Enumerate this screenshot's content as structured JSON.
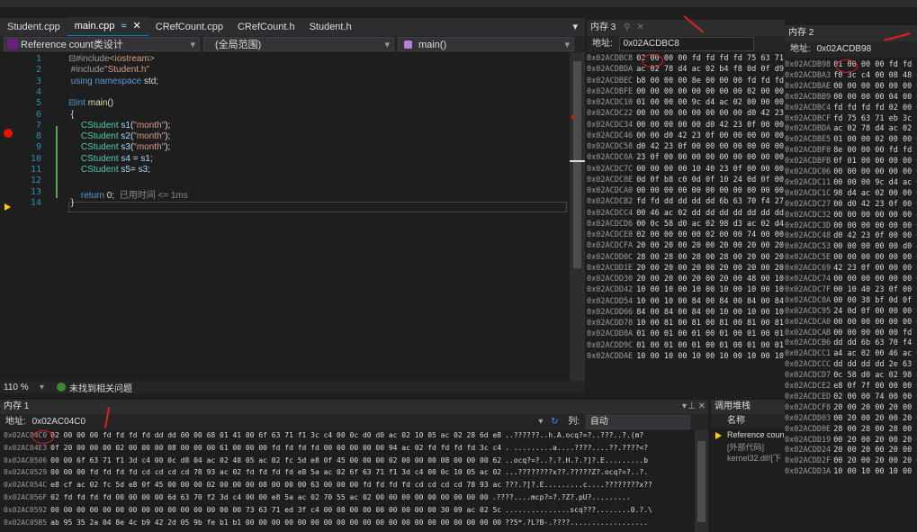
{
  "tabs": [
    {
      "label": "Student.cpp",
      "active": false
    },
    {
      "label": "main.cpp",
      "active": true,
      "pin": "≈",
      "close": "✕"
    },
    {
      "label": "CRefCount.cpp",
      "active": false
    },
    {
      "label": "CRefCount.h",
      "active": false
    },
    {
      "label": "Student.h",
      "active": false
    }
  ],
  "editor_header": {
    "project": "Reference count类设计",
    "scope": "(全局范围)",
    "function": "main()"
  },
  "code_lines": [
    {
      "n": "1",
      "html": "<span class='pp'>⊟#include</span><span class='inc'>&lt;iostream&gt;</span>"
    },
    {
      "n": "2",
      "html": " <span class='pp'>#include</span><span class='inc'>\"Student.h\"</span>"
    },
    {
      "n": "3",
      "html": " <span class='kw'>using namespace</span> std;"
    },
    {
      "n": "4",
      "html": ""
    },
    {
      "n": "5",
      "html": "<span class='kw'>⊟int</span> <span class='fn'>main</span>()"
    },
    {
      "n": "6",
      "html": " {"
    },
    {
      "n": "7",
      "html": "     <span class='cls'>CStudent</span> <span class='id'>s1</span>(<span class='str'>\"month\"</span>);"
    },
    {
      "n": "8",
      "html": "     <span class='cls'>CStudent</span> <span class='id'>s2</span>(<span class='str'>\"month\"</span>);"
    },
    {
      "n": "9",
      "html": "     <span class='cls'>CStudent</span> <span class='id'>s3</span>(<span class='str'>\"month\"</span>);"
    },
    {
      "n": "10",
      "html": "     <span class='cls'>CStudent</span> <span class='id'>s4</span> = <span class='id'>s1</span>;"
    },
    {
      "n": "11",
      "html": "     <span class='cls'>CStudent</span> <span class='id'>s5</span>= <span class='id'>s3</span>;"
    },
    {
      "n": "12",
      "html": ""
    },
    {
      "n": "13",
      "html": "     <span class='kw'>return</span> 0;  <span style='color:#8a8a8a'>已用时间 &lt;= 1ms</span>"
    },
    {
      "n": "14",
      "html": " }"
    }
  ],
  "status": {
    "zoom": "110 %",
    "issues": "未找到相关问题"
  },
  "mem3": {
    "title": "内存 3",
    "address_label": "地址:",
    "address": "0x02ACDBC8",
    "rows": [
      [
        "0x02ACDBC8",
        "02 00 00 00 fd fd fd fd 75 63 71 eb 3c"
      ],
      [
        "0x02ACDBDA",
        "ac 02 78 d4 ac 02 b4 f8 0d 0f d9 01 0"
      ],
      [
        "0x02ACDBEC",
        "b8 00 00 00 8e 00 00 00 fd fd fd fd b8"
      ],
      [
        "0x02ACDBFE",
        "00 00 00 00 00 00 00 00 02 00 00 00 00"
      ],
      [
        "0x02ACDC10",
        "01 00 00 00 9c d4 ac 02 00 00 00 00 98"
      ],
      [
        "0x02ACDC22",
        "00 00 00 00 00 00 00 00 d0 42 23 0f 00"
      ],
      [
        "0x02ACDC34",
        "00 00 00 00 00 d0 42 23 0f 00 00 00 00"
      ],
      [
        "0x02ACDC46",
        "00 00 d0 42 23 0f 00 00 00 00 00 00 00"
      ],
      [
        "0x02ACDC58",
        "d0 42 23 0f 00 00 00 00 00 00 00 00 00"
      ],
      [
        "0x02ACDC6A",
        "23 0f 00 00 00 00 00 00 00 00 00 00 00"
      ],
      [
        "0x02ACDC7C",
        "00 00 00 00 10 40 23 0f 00 00 00 00 00"
      ],
      [
        "0x02ACDC8E",
        "0d 0f b8 c0 0d 0f 10 24 0d 0f 00 00 00"
      ],
      [
        "0x02ACDCA0",
        "00 00 00 00 00 00 00 00 00 00 00 00 00"
      ],
      [
        "0x02ACDCB2",
        "fd fd dd dd dd dd 6b 63 70 f4 27 c4 0"
      ],
      [
        "0x02ACDCC4",
        "00 46 ac 02 dd dd dd dd dd dd dd dd dd"
      ],
      [
        "0x02ACDCD6",
        "00 0c 58 d0 ac 02 98 d3 ac 02 d4 58 e"
      ],
      [
        "0x02ACDCE8",
        "02 00 00 00 00 02 00 00 74 00 00 00 fd"
      ],
      [
        "0x02ACDCFA",
        "20 00 20 00 20 00 20 00 20 00 20 00 20"
      ],
      [
        "0x02ACDD0C",
        "28 00 28 00 28 00 28 00 20 00 20 00 2"
      ],
      [
        "0x02ACDD1E",
        "20 00 20 00 20 00 20 00 20 00 20 00 2"
      ],
      [
        "0x02ACDD30",
        "20 00 20 00 20 00 20 00 48 00 10 00 1"
      ],
      [
        "0x02ACDD42",
        "10 00 10 00 10 00 10 00 10 00 10 00 1"
      ],
      [
        "0x02ACDD54",
        "10 00 10 00 84 00 84 00 84 00 84 00 8"
      ],
      [
        "0x02ACDD66",
        "84 00 84 00 84 00 10 00 10 00 10 00 1"
      ],
      [
        "0x02ACDD78",
        "10 00 81 00 81 00 81 00 81 00 81 00 8"
      ],
      [
        "0x02ACDD8A",
        "01 00 01 00 01 00 01 00 01 00 01 00 0"
      ],
      [
        "0x02ACDD9C",
        "01 00 01 00 01 00 01 00 01 00 01 00 0"
      ],
      [
        "0x02ACDDAE",
        "10 00 10 00 10 00 10 00 10 00 10 00 8"
      ]
    ]
  },
  "mem2": {
    "title": "内存 2",
    "address_label": "地址:",
    "address": "0x02ACDB98",
    "rows": [
      [
        "0x02ACDB98",
        "01 00 00 00 fd fd fd fd"
      ],
      [
        "0x02ACDBA3",
        "f0 3c c4 00 08 48 e8"
      ],
      [
        "0x02ACDBAE",
        "00 00 00 00 00 00 00"
      ],
      [
        "0x02ACDBB9",
        "00 00 00 00 04 00 00"
      ],
      [
        "0x02ACDBC4",
        "fd fd fd fd 02 00 00"
      ],
      [
        "0x02ACDBCF",
        "fd 75 63 71 eb 3c c4"
      ],
      [
        "0x02ACDBDA",
        "ac 02 78 d4 ac 02 b4"
      ],
      [
        "0x02ACDBE5",
        "01 00 00 02 00 00 00"
      ],
      [
        "0x02ACDBF0",
        "8e 00 00 00 fd fd fd"
      ],
      [
        "0x02ACDBFB",
        "0f 01 00 00 00 00 00"
      ],
      [
        "0x02ACDC06",
        "00 00 00 00 00 00 00"
      ],
      [
        "0x02ACDC11",
        "00 00 00 9c d4 ac 02"
      ],
      [
        "0x02ACDC1C",
        "98 d4 ac 02 00 00 00"
      ],
      [
        "0x02ACDC27",
        "00 d0 42 23 0f 00 00"
      ],
      [
        "0x02ACDC32",
        "00 00 00 00 00 00 d0"
      ],
      [
        "0x02ACDC3D",
        "00 00 00 00 00 00 00"
      ],
      [
        "0x02ACDC48",
        "d0 42 23 0f 00 00 00"
      ],
      [
        "0x02ACDC53",
        "00 00 00 00 00 d0 42"
      ],
      [
        "0x02ACDC5E",
        "00 00 00 00 00 00 00"
      ],
      [
        "0x02ACDC69",
        "42 23 0f 00 00 00 00"
      ],
      [
        "0x02ACDC74",
        "00 00 00 00 00 00 00"
      ],
      [
        "0x02ACDC7F",
        "00 10 40 23 0f 00 00"
      ],
      [
        "0x02ACDC8A",
        "00 00 38 bf 0d 0f b8"
      ],
      [
        "0x02ACDC95",
        "24 0d 0f 00 00 00 00"
      ],
      [
        "0x02ACDCA0",
        "00 00 00 00 00 00 00"
      ],
      [
        "0x02ACDCAB",
        "00 00 00 00 00 fd fd"
      ],
      [
        "0x02ACDCB6",
        "dd dd 6b 63 70 f4 27"
      ],
      [
        "0x02ACDCC1",
        "a4 ac 02 00 46 ac 02"
      ],
      [
        "0x02ACDCCC",
        "dd dd dd dd 2e 63 7"
      ],
      [
        "0x02ACDCD7",
        "0c 58 d0 ac 02 98 d3"
      ],
      [
        "0x02ACDCE2",
        "e8 0f 7f 00 00 00 02"
      ],
      [
        "0x02ACDCED",
        "02 00 00 74 00 00 00"
      ],
      [
        "0x02ACDCF8",
        "20 00 20 00 20 00 20"
      ],
      [
        "0x02ACDD03",
        "00 20 00 20 00 20 00"
      ],
      [
        "0x02ACDD0E",
        "28 00 28 00 28 00 20"
      ],
      [
        "0x02ACDD19",
        "00 20 00 20 00 20 00"
      ],
      [
        "0x02ACDD24",
        "20 00 20 00 20 00 20"
      ],
      [
        "0x02ACDD2F",
        "00 20 00 20 00 20 00"
      ],
      [
        "0x02ACDD3A",
        "10 00 10 00 10 00 10"
      ]
    ]
  },
  "mem1": {
    "title": "内存 1",
    "address_label": "地址:",
    "address": "0x02AC04C0",
    "col_label": "列:",
    "col_value": "自动",
    "rows": [
      [
        "0x02AC04C0",
        "02 00 00 00 fd fd fd fd dd dd 00 00 68 01 41 00 6f 63 71 f1 3c c4 00 0c d0 d0 ac 02 10 05 ac 02 28 6d e8",
        "..??????..h.A.ocq?=?..???..?.(m?"
      ],
      [
        "0x02AC04E3",
        "0f 20 00 00 00 02 00 00 00 08 00 00 00 61 00 00 00 fd fd fd fd 00 00 00 00 00 94 ac 02 fd fd fd fd 3c c4",
        ". .........a....????....??.????<?"
      ],
      [
        "0x02AC0506",
        "00 00 6f 63 71 f1 3d c4 00 0c d8 04 ac 02 48 05 ac 02 fc 5d e8 0f 45 00 00 00 02 00 00 00 08 00 00 00 62",
        "..ocq?=?..?.?.H.?.?]?.E.........b"
      ],
      [
        "0x02AC0529",
        "00 00 00 fd fd fd fd cd cd cd cd 78 93 ac 02 fd fd fd fd e8 5a ac 02 6f 63 71 f1 3d c4 00 0c 10 05 ac 02",
        "...????????x??.?????Z?.ocq?=?..?."
      ],
      [
        "0x02AC054C",
        "e8 cf ac 02 fc 5d e8 0f 45 00 00 00 02 00 00 00 08 00 00 00 63 00 00 00 fd fd fd fd cd cd cd cd 78 93 ac",
        "???.?]?.E.........c....????????x??"
      ],
      [
        "0x02AC056F",
        "02 fd fd fd fd 00 00 00 00 6d 63 70 f2 3d c4 00 00 e8 5a ac 02 70 55 ac 02 00 00 00 00 00 00 00 00 00",
        ".????....mcp?=?.?Z?.pU?........."
      ],
      [
        "0x02AC0592",
        "00 00 00 00 00 00 00 00 00 00 00 00 00 00 00 73 63 71 ed 3f c4 00 08 00 00 00 00 00 00 00 30 09 ac 02 5c",
        "...............scq???........0.?.\\"
      ],
      [
        "0x02AC05B5",
        "ab 95 35 2a 04 8e 4c b9 42 2d 05 9b fe b1 b1 00 00 00 00 00 00 00 00 00 00 00 00 00 00 00 00 00 00 00 00",
        "??5*.?L?B-.????.................."
      ]
    ]
  },
  "callstack": {
    "title": "调用堆栈",
    "col_name": "名称",
    "rows": [
      "Reference coun",
      "[外部代码]",
      "kernel32.dll![下"
    ]
  }
}
